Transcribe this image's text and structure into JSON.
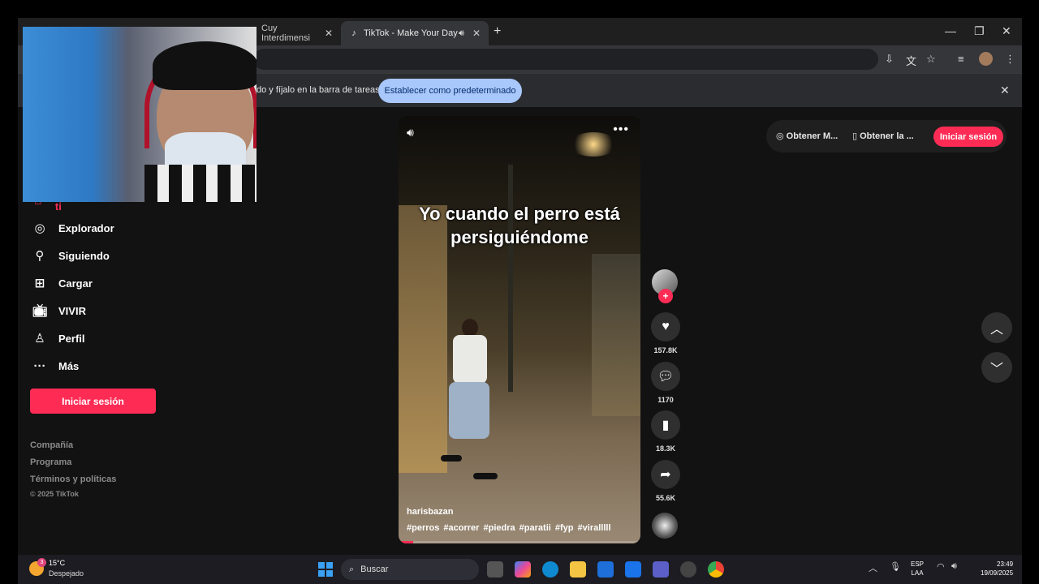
{
  "browser": {
    "tabs": [
      {
        "title": "Cuy Interdimensi"
      },
      {
        "title": "TikTok - Make Your Day"
      }
    ]
  },
  "infobar": {
    "message": "do y fíjalo en la barra de tareas",
    "button": "Establecer como predeterminado"
  },
  "sidebar": {
    "items": [
      {
        "label": "Para ti",
        "icon": "home-icon"
      },
      {
        "label": "Explorador",
        "icon": "compass-icon"
      },
      {
        "label": "Siguiendo",
        "icon": "following-icon"
      },
      {
        "label": "Cargar",
        "icon": "upload-icon"
      },
      {
        "label": "VIVIR",
        "icon": "live-icon"
      },
      {
        "label": "Perfil",
        "icon": "profile-icon"
      },
      {
        "label": "Más",
        "icon": "more-icon"
      }
    ],
    "login_button": "Iniciar sesión",
    "footer": [
      "Compañía",
      "Programa",
      "Términos y políticas"
    ],
    "copyright": "© 2025 TikTok"
  },
  "video": {
    "caption": "Yo cuando el perro está persiguiéndome",
    "author": "harisbazan",
    "tags": "#perros #acorrer #piedra #paratii #fyp #viralllll",
    "progress_fraction": 0.06
  },
  "actions": {
    "likes": "157.8K",
    "comments": "1170",
    "saves": "18.3K",
    "shares": "55.6K"
  },
  "topbar": {
    "get_app": "Obtener M...",
    "get_desktop": "Obtener la ...",
    "login": "Iniciar sesión"
  },
  "taskbar": {
    "temperature": "15°C",
    "weather": "Despejado",
    "weather_badge": "3",
    "search": "Buscar",
    "lang1": "ESP",
    "lang2": "LAA",
    "time": "23:49",
    "date": "19/09/2025"
  },
  "colors": {
    "accent": "#fe2c55",
    "background": "#121212",
    "infobar_button": "#a8c7fa"
  }
}
